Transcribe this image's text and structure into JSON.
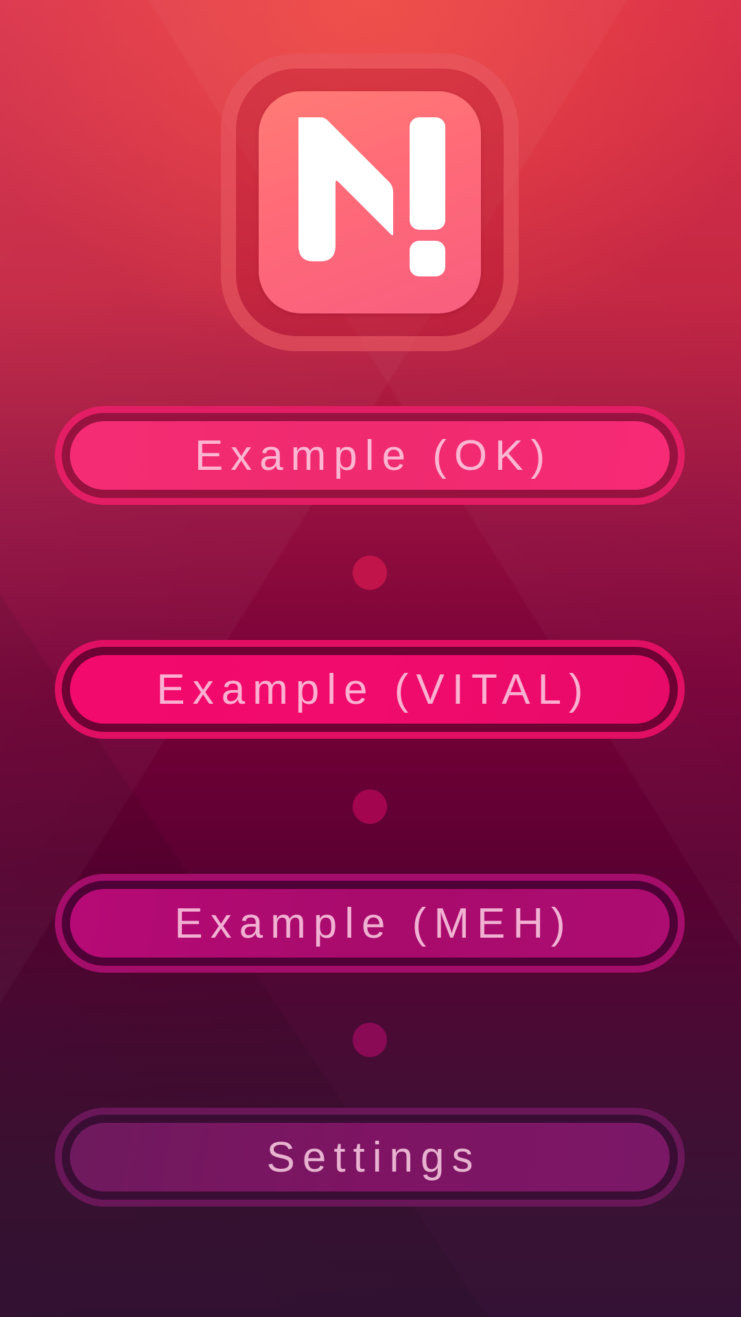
{
  "logo": {
    "icon": "n-exclamation-logo",
    "colors": {
      "frame": "#ff7676",
      "tile": "#ff6f78",
      "glyph": "#ffffff"
    }
  },
  "menu": {
    "ok_label": "Example (OK)",
    "vital_label": "Example (VITAL)",
    "meh_label": "Example (MEH)",
    "settings_label": "Settings"
  },
  "colors": {
    "ok": "#f52c74",
    "vital": "#f00b6c",
    "meh": "#b70a76",
    "settings": "#7e1463",
    "background_top": "#d72c48",
    "background_bottom": "#341235"
  }
}
